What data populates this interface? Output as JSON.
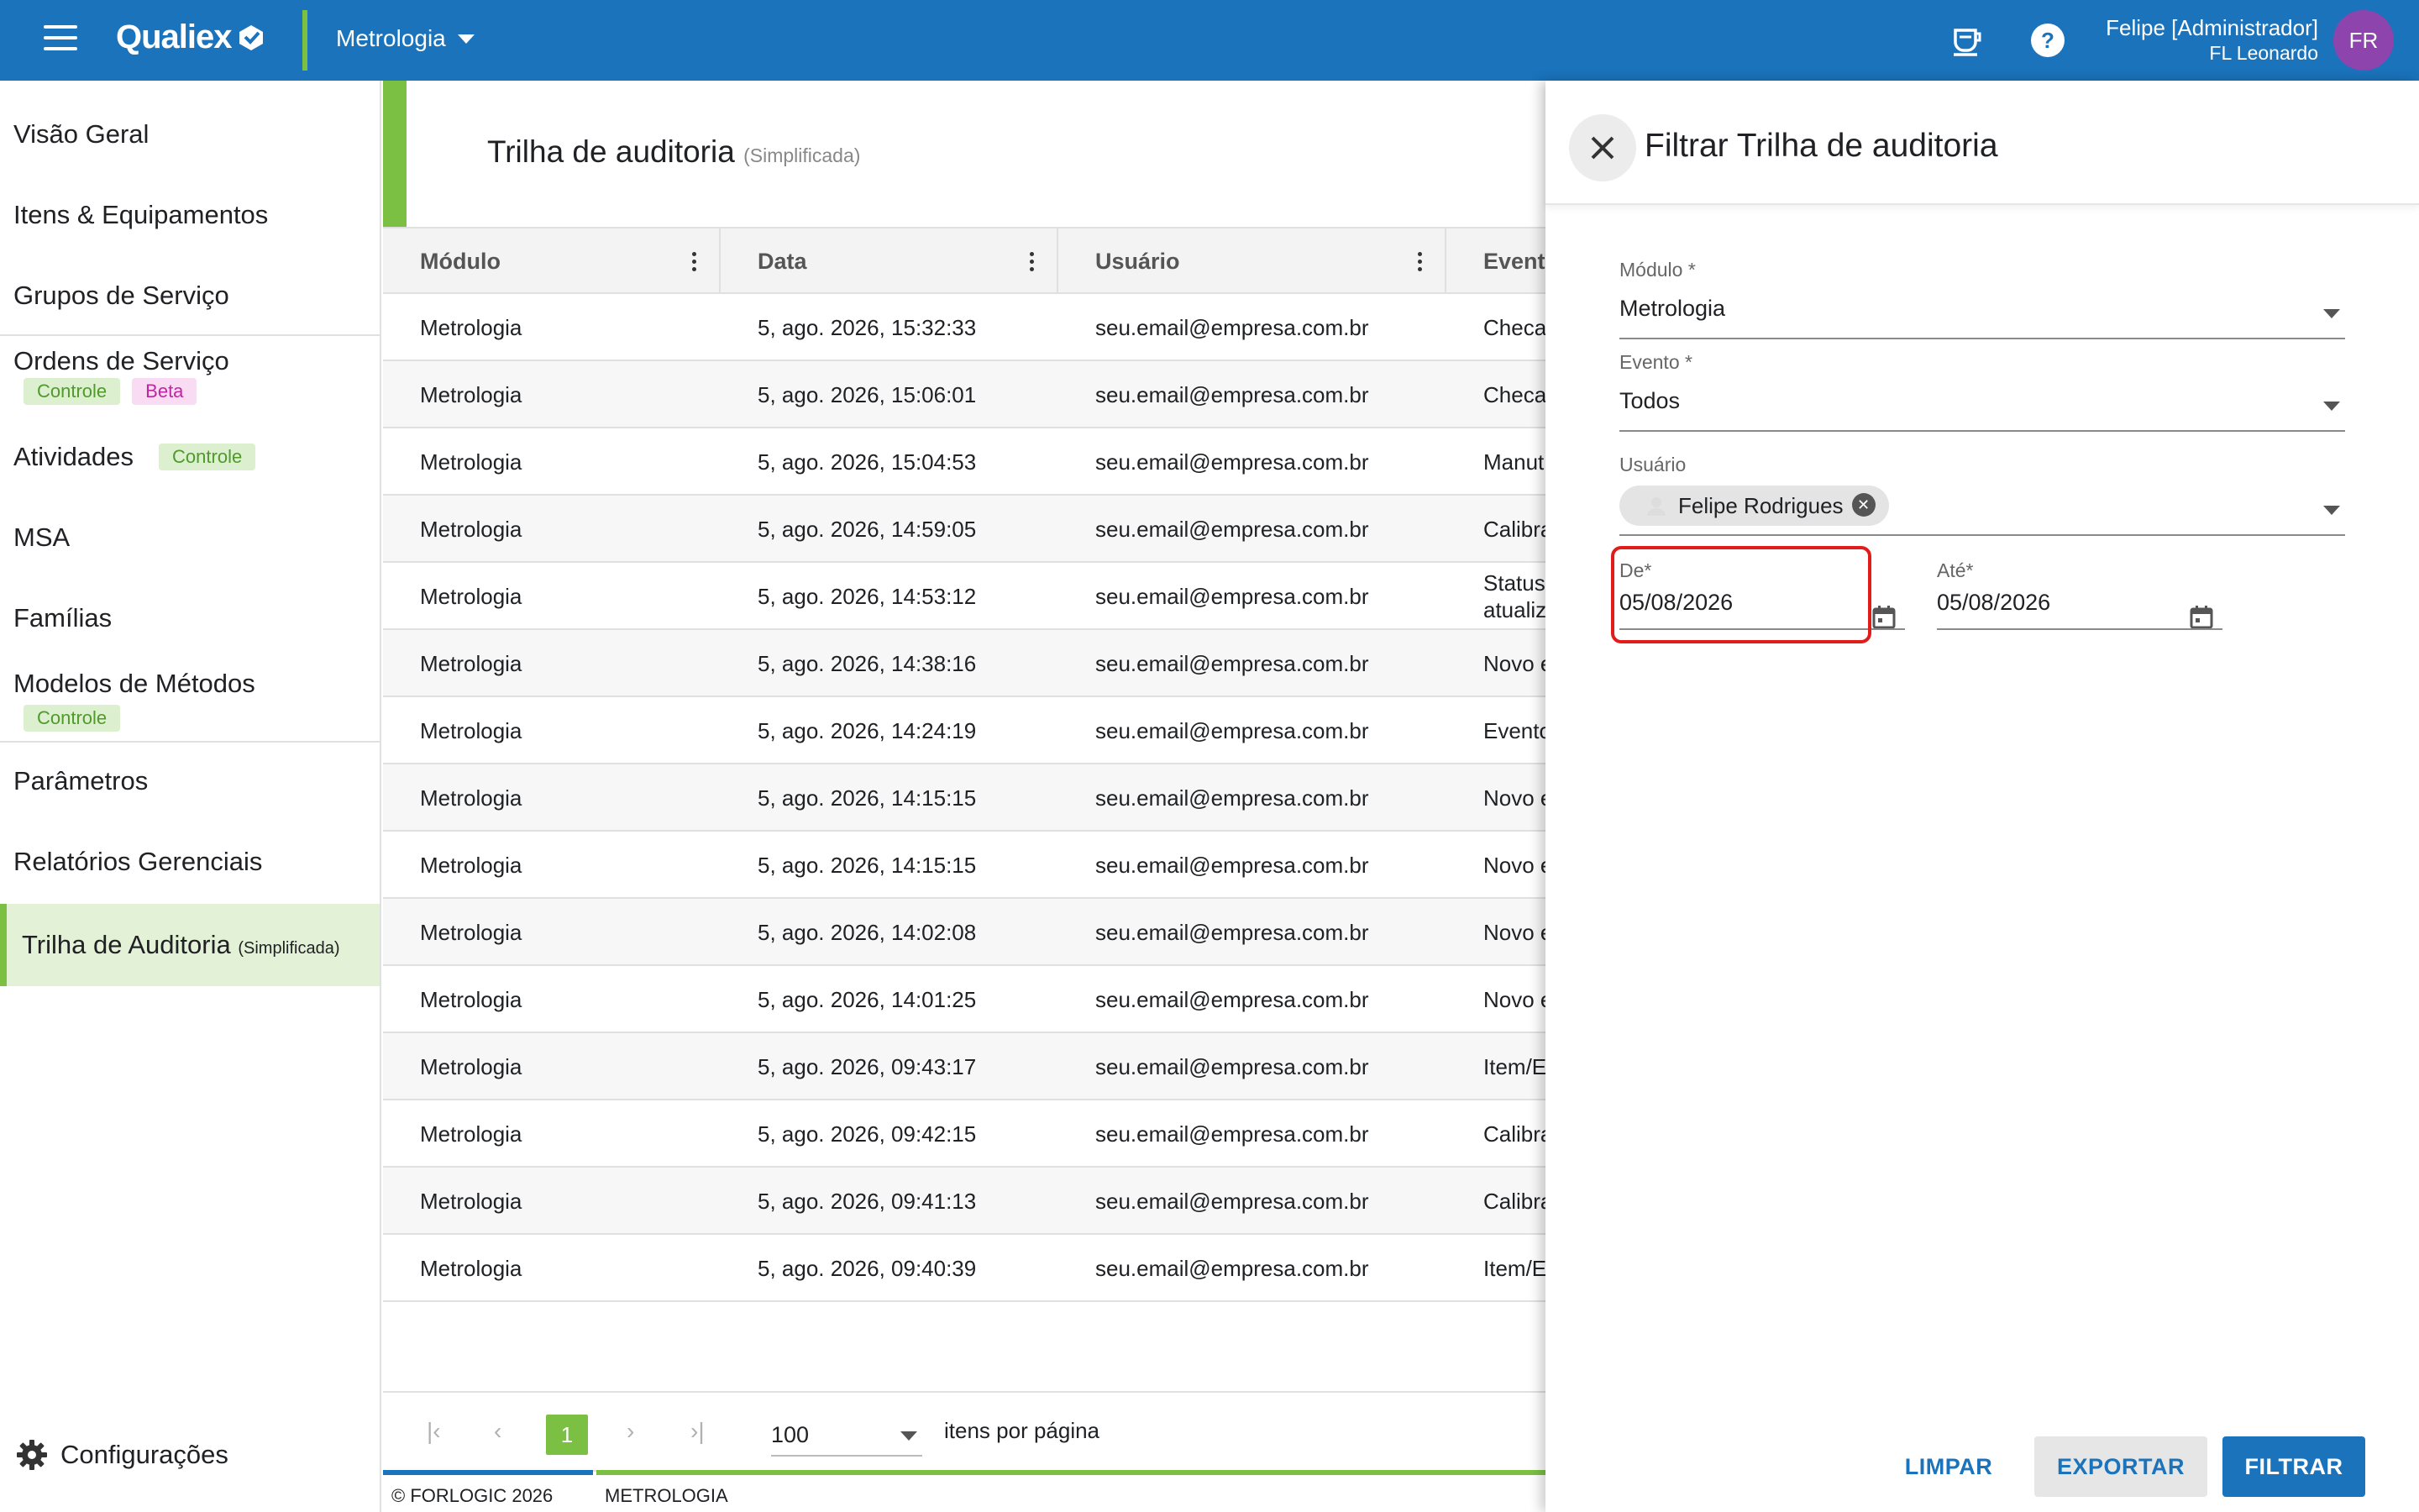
{
  "header": {
    "app_name": "Qualiex",
    "module": "Metrologia",
    "user_name": "Felipe [Administrador]",
    "user_org": "FL Leonardo",
    "avatar_initials": "FR",
    "colors": {
      "bar": "#1a73bb",
      "accent": "#7bc043",
      "avatar": "#8e44ad"
    }
  },
  "sidebar": {
    "items": [
      {
        "label": "Visão Geral"
      },
      {
        "label": "Itens & Equipamentos"
      },
      {
        "label": "Grupos de Serviço"
      },
      {
        "label": "Ordens de Serviço",
        "badges": [
          "Controle",
          "Beta"
        ]
      },
      {
        "label": "Atividades",
        "badges": [
          "Controle"
        ]
      },
      {
        "label": "MSA"
      },
      {
        "label": "Famílias"
      },
      {
        "label": "Modelos de Métodos",
        "badges": [
          "Controle"
        ]
      },
      {
        "label": "Parâmetros"
      },
      {
        "label": "Relatórios Gerenciais"
      },
      {
        "label": "Trilha de Auditoria",
        "suffix": "(Simplificada)"
      }
    ],
    "settings_label": "Configurações"
  },
  "main": {
    "title": "Trilha de auditoria",
    "subtitle": "(Simplificada)",
    "columns": [
      "Módulo",
      "Data",
      "Usuário",
      "Evento"
    ],
    "rows": [
      {
        "modulo": "Metrologia",
        "data": "5, ago. 2026, 15:32:33",
        "usuario": "seu.email@empresa.com.br",
        "evento": "Checa"
      },
      {
        "modulo": "Metrologia",
        "data": "5, ago. 2026, 15:06:01",
        "usuario": "seu.email@empresa.com.br",
        "evento": "Checa"
      },
      {
        "modulo": "Metrologia",
        "data": "5, ago. 2026, 15:04:53",
        "usuario": "seu.email@empresa.com.br",
        "evento": "Manut"
      },
      {
        "modulo": "Metrologia",
        "data": "5, ago. 2026, 14:59:05",
        "usuario": "seu.email@empresa.com.br",
        "evento": "Calibra"
      },
      {
        "modulo": "Metrologia",
        "data": "5, ago. 2026, 14:53:12",
        "usuario": "seu.email@empresa.com.br",
        "evento": "Status",
        "evento2": "atualiz"
      },
      {
        "modulo": "Metrologia",
        "data": "5, ago. 2026, 14:38:16",
        "usuario": "seu.email@empresa.com.br",
        "evento": "Novo e"
      },
      {
        "modulo": "Metrologia",
        "data": "5, ago. 2026, 14:24:19",
        "usuario": "seu.email@empresa.com.br",
        "evento": "Evento"
      },
      {
        "modulo": "Metrologia",
        "data": "5, ago. 2026, 14:15:15",
        "usuario": "seu.email@empresa.com.br",
        "evento": "Novo e"
      },
      {
        "modulo": "Metrologia",
        "data": "5, ago. 2026, 14:15:15",
        "usuario": "seu.email@empresa.com.br",
        "evento": "Novo e"
      },
      {
        "modulo": "Metrologia",
        "data": "5, ago. 2026, 14:02:08",
        "usuario": "seu.email@empresa.com.br",
        "evento": "Novo e"
      },
      {
        "modulo": "Metrologia",
        "data": "5, ago. 2026, 14:01:25",
        "usuario": "seu.email@empresa.com.br",
        "evento": "Novo e"
      },
      {
        "modulo": "Metrologia",
        "data": "5, ago. 2026, 09:43:17",
        "usuario": "seu.email@empresa.com.br",
        "evento": "Item/E"
      },
      {
        "modulo": "Metrologia",
        "data": "5, ago. 2026, 09:42:15",
        "usuario": "seu.email@empresa.com.br",
        "evento": "Calibra"
      },
      {
        "modulo": "Metrologia",
        "data": "5, ago. 2026, 09:41:13",
        "usuario": "seu.email@empresa.com.br",
        "evento": "Calibra"
      },
      {
        "modulo": "Metrologia",
        "data": "5, ago. 2026, 09:40:39",
        "usuario": "seu.email@empresa.com.br",
        "evento": "Item/E"
      }
    ],
    "pager": {
      "current_page": "1",
      "per_page": "100",
      "per_page_label": "itens por página"
    }
  },
  "footer": {
    "copyright": "© FORLOGIC 2026",
    "module": "METROLOGIA"
  },
  "filter": {
    "title": "Filtrar Trilha de auditoria",
    "modulo_label": "Módulo *",
    "modulo_value": "Metrologia",
    "evento_label": "Evento *",
    "evento_value": "Todos",
    "usuario_label": "Usuário",
    "usuario_chip": "Felipe Rodrigues",
    "de_label": "De*",
    "de_value": "05/08/2026",
    "ate_label": "Até*",
    "ate_value": "05/08/2026",
    "btn_limpar": "LIMPAR",
    "btn_exportar": "EXPORTAR",
    "btn_filtrar": "FILTRAR",
    "highlight_color": "#e21b1b"
  }
}
